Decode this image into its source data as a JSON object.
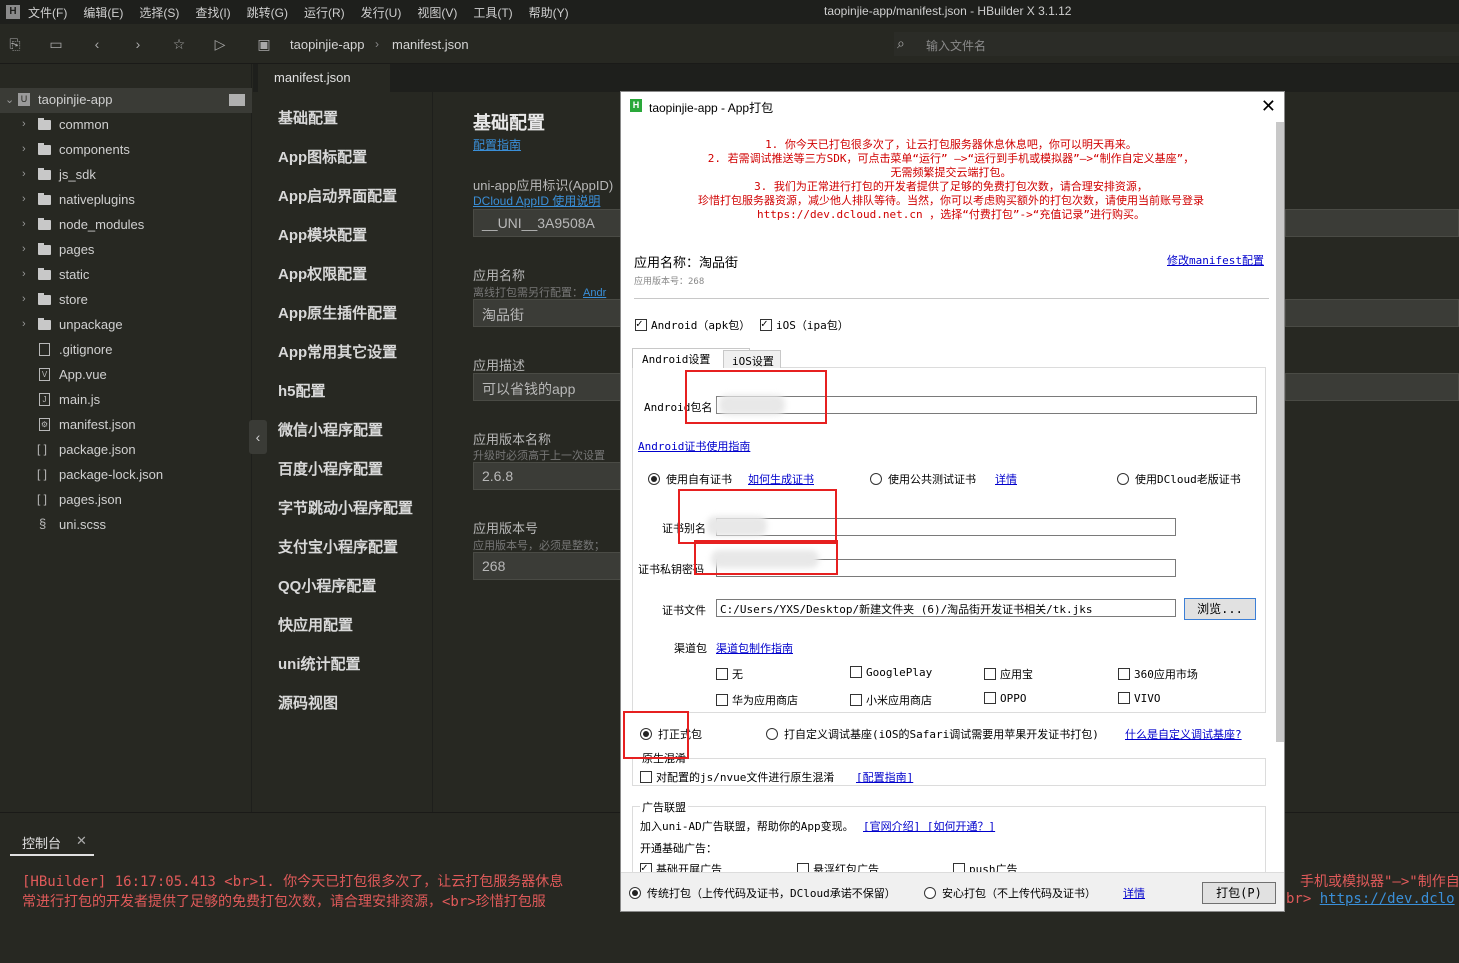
{
  "menubar": {
    "items": [
      "文件(F)",
      "编辑(E)",
      "选择(S)",
      "查找(I)",
      "跳转(G)",
      "运行(R)",
      "发行(U)",
      "视图(V)",
      "工具(T)",
      "帮助(Y)"
    ],
    "window_title": "taopinjie-app/manifest.json - HBuilder X 3.1.12"
  },
  "toolbar": {
    "breadcrumb": [
      "taopinjie-app",
      "manifest.json"
    ],
    "file_search_placeholder": "输入文件名"
  },
  "sidebar": {
    "root": "taopinjie-app",
    "folders": [
      "common",
      "components",
      "js_sdk",
      "nativeplugins",
      "node_modules",
      "pages",
      "static",
      "store",
      "unpackage"
    ],
    "files": [
      ".gitignore",
      "App.vue",
      "main.js",
      "manifest.json",
      "package.json",
      "package-lock.json",
      "pages.json",
      "uni.scss"
    ]
  },
  "editor": {
    "tab": "manifest.json"
  },
  "settings_nav": [
    "基础配置",
    "App图标配置",
    "App启动界面配置",
    "App模块配置",
    "App权限配置",
    "App原生插件配置",
    "App常用其它设置",
    "h5配置",
    "微信小程序配置",
    "百度小程序配置",
    "字节跳动小程序配置",
    "支付宝小程序配置",
    "QQ小程序配置",
    "快应用配置",
    "uni统计配置",
    "源码视图"
  ],
  "settings": {
    "title": "基础配置",
    "guide_link": "配置指南",
    "appid_label": "uni-app应用标识(AppID)",
    "appid_link": "DCloud AppID 使用说明",
    "appid_value": "__UNI__3A9508A",
    "name_label": "应用名称",
    "name_hint": "离线打包需另行配置：",
    "name_hint_link": "Andr",
    "name_value": "淘品街",
    "desc_label": "应用描述",
    "desc_value": "可以省钱的app",
    "version_name_label": "应用版本名称",
    "version_name_hint": "升级时必须高于上一次设置",
    "version_name_value": "2.6.8",
    "version_code_label": "应用版本号",
    "version_code_hint": "应用版本号，必须是整数；",
    "version_code_value": "268"
  },
  "console": {
    "tab": "控制台",
    "line1_left": "[HBuilder] 16:17:05.413 <br>1. 你今天已打包很多次了，让云打包服务器休息",
    "line1_right": "手机或模拟器\"—>\"制作自",
    "line2_left": "常进行打包的开发者提供了足够的免费打包次数，请合理安排资源，<br>珍惜打包服",
    "line2_right_prefix": "br> ",
    "line2_right_link": "https://dev.dclo"
  },
  "dialog": {
    "title": "taopinjie-app - App打包",
    "notice": [
      "1. 你今天已打包很多次了，让云打包服务器休息休息吧，你可以明天再来。",
      "2. 若需调试推送等三方SDK，可点击菜单“运行” —>“运行到手机或模拟器”—>“制作自定义基座”，",
      "无需频繁提交云端打包。",
      "3. 我们为正常进行打包的开发者提供了足够的免费打包次数，请合理安排资源，",
      "珍惜打包服务器资源，减少他人排队等待。当然，你可以考虑购买额外的打包次数，请使用当前账号登录",
      "https://dev.dcloud.net.cn ，选择“付费打包”->“充值记录”进行购买。"
    ],
    "app_name": "应用名称：淘品街",
    "app_version": "应用版本号：268",
    "edit_manifest": "修改manifest配置",
    "platform_android": "Android（apk包）",
    "platform_ios": "iOS（ipa包）",
    "tab_android": "Android设置",
    "tab_ios": "iOS设置",
    "package_label": "Android包名",
    "cert_guide": "Android证书使用指南",
    "cert_own": "使用自有证书",
    "cert_how": "如何生成证书",
    "cert_public": "使用公共测试证书",
    "cert_detail": "详情",
    "cert_old": "使用DCloud老版证书",
    "alias_label": "证书别名",
    "password_label": "证书私钥密码",
    "file_label": "证书文件",
    "file_value": "C:/Users/YXS/Desktop/新建文件夹 (6)/淘品街开发证书相关/tk.jks",
    "browse": "浏览...",
    "channel_label": "渠道包",
    "channel_guide": "渠道包制作指南",
    "channels": [
      "无",
      "GooglePlay",
      "应用宝",
      "360应用市场",
      "华为应用商店",
      "小米应用商店",
      "OPPO",
      "VIVO"
    ],
    "mode_release": "打正式包",
    "mode_custom": "打自定义调试基座(iOS的Safari调试需要用苹果开发证书打包)",
    "mode_custom_link": "什么是自定义调试基座?",
    "obfuscate_title": "原生混淆",
    "obfuscate_option": "对配置的js/nvue文件进行原生混淆",
    "obfuscate_link": "[配置指南]",
    "ad_title": "广告联盟",
    "ad_desc": "加入uni-AD广告联盟，帮助你的App变现。",
    "ad_links": "[官网介绍] [如何开通？]",
    "ad_basic": "开通基础广告：",
    "ad_items": [
      "基础开屏广告",
      "悬浮红包广告",
      "push广告"
    ],
    "pack_traditional": "传统打包（上传代码及证书，DCloud承诺不保留）",
    "pack_safe": "安心打包（不上传代码及证书）",
    "pack_detail": "详情",
    "pack_button": "打包(P)"
  }
}
